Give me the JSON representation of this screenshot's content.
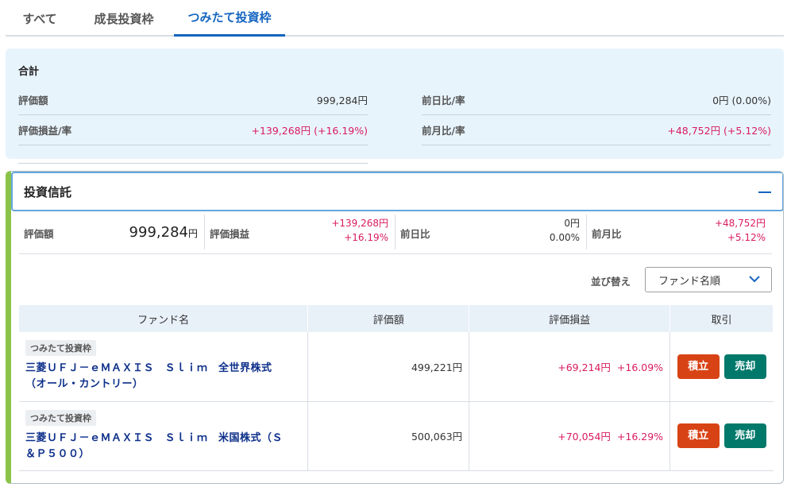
{
  "tabs": [
    "すべて",
    "成長投資枠",
    "つみたて投資枠"
  ],
  "summary": {
    "title": "合計",
    "rows": [
      {
        "label": "評価額",
        "value": "999,284円",
        "positive": false
      },
      {
        "label": "前日比/率",
        "value": "0円 (0.00%)",
        "positive": false
      },
      {
        "label": "評価損益/率",
        "value": "+139,268円 (+16.19%)",
        "positive": true
      },
      {
        "label": "前月比/率",
        "value": "+48,752円 (+5.12%)",
        "positive": true
      }
    ]
  },
  "card": {
    "title": "投資信託",
    "metrics": {
      "valuation_label": "評価額",
      "valuation_value": "999,284",
      "valuation_unit": "円",
      "pl_label": "評価損益",
      "pl_amount": "+139,268円",
      "pl_rate": "+16.19%",
      "day_label": "前日比",
      "day_amount": "0円",
      "day_rate": "0.00%",
      "month_label": "前月比",
      "month_amount": "+48,752円",
      "month_rate": "+5.12%"
    },
    "sort_label": "並び替え",
    "sort_value": "ファンド名順",
    "table_headers": [
      "ファンド名",
      "評価額",
      "評価損益",
      "取引"
    ],
    "funds": [
      {
        "badge": "つみたて投資枠",
        "name_line1": "三菱ＵＦＪ－ｅＭＡＸＩＳ　Ｓｌｉｍ　全世界株式",
        "name_line2": "（オール・カントリー）",
        "valuation": "499,221円",
        "pl_amount": "+69,214円",
        "pl_rate": "+16.09%"
      },
      {
        "badge": "つみたて投資枠",
        "name_line1": "三菱ＵＦＪ－ｅＭＡＸＩＳ　Ｓｌｉｍ　米国株式（Ｓ",
        "name_line2": "＆Ｐ５００）",
        "valuation": "500,063円",
        "pl_amount": "+70,054円",
        "pl_rate": "+16.29%"
      }
    ],
    "buy_label": "積立",
    "sell_label": "売却"
  },
  "colors": {
    "accent": "#1565c0",
    "positive": "#d81b60",
    "buy": "#d84315",
    "sell": "#00796b",
    "card_strip": "#8bc34a"
  }
}
